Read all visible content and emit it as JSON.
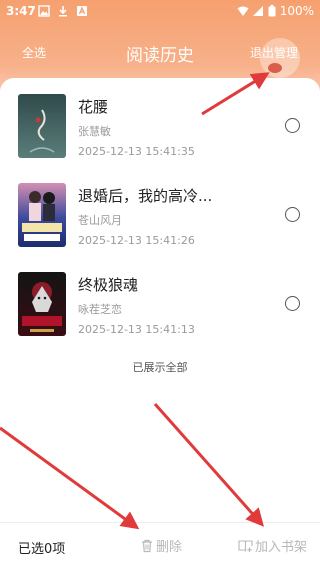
{
  "status_bar": {
    "time": "3:47",
    "battery": "100%",
    "icons": [
      "image-icon",
      "download-icon",
      "a-icon",
      "wifi-icon",
      "signal-icon",
      "battery-icon"
    ]
  },
  "nav": {
    "select_all": "全选",
    "title": "阅读历史",
    "exit_manage": "退出管理"
  },
  "books": [
    {
      "title": "花腰",
      "author": "张慧敏",
      "time": "2025-12-13 15:41:35",
      "cover_colors": [
        "#2f4a4a",
        "#5b7e7b"
      ],
      "checked": false
    },
    {
      "title": "退婚后，我的高冷...",
      "author": "苍山风月",
      "time": "2025-12-13 15:41:26",
      "cover_colors": [
        "#1f2d6e",
        "#d48fb2"
      ],
      "checked": false
    },
    {
      "title": "终极狼魂",
      "author": "咏茬芝恋",
      "time": "2025-12-13 15:41:13",
      "cover_colors": [
        "#141414",
        "#8b1d2a"
      ],
      "checked": false
    }
  ],
  "list_footer": "已展示全部",
  "bottom_bar": {
    "selected_count": "已选0项",
    "delete": "删除",
    "add_to_shelf": "加入书架"
  },
  "colors": {
    "header_top": "#f6a06f",
    "header_bottom": "#fbe3d6",
    "disabled_text": "#b8b8b8",
    "annotation_arrow": "#e03a3a"
  }
}
